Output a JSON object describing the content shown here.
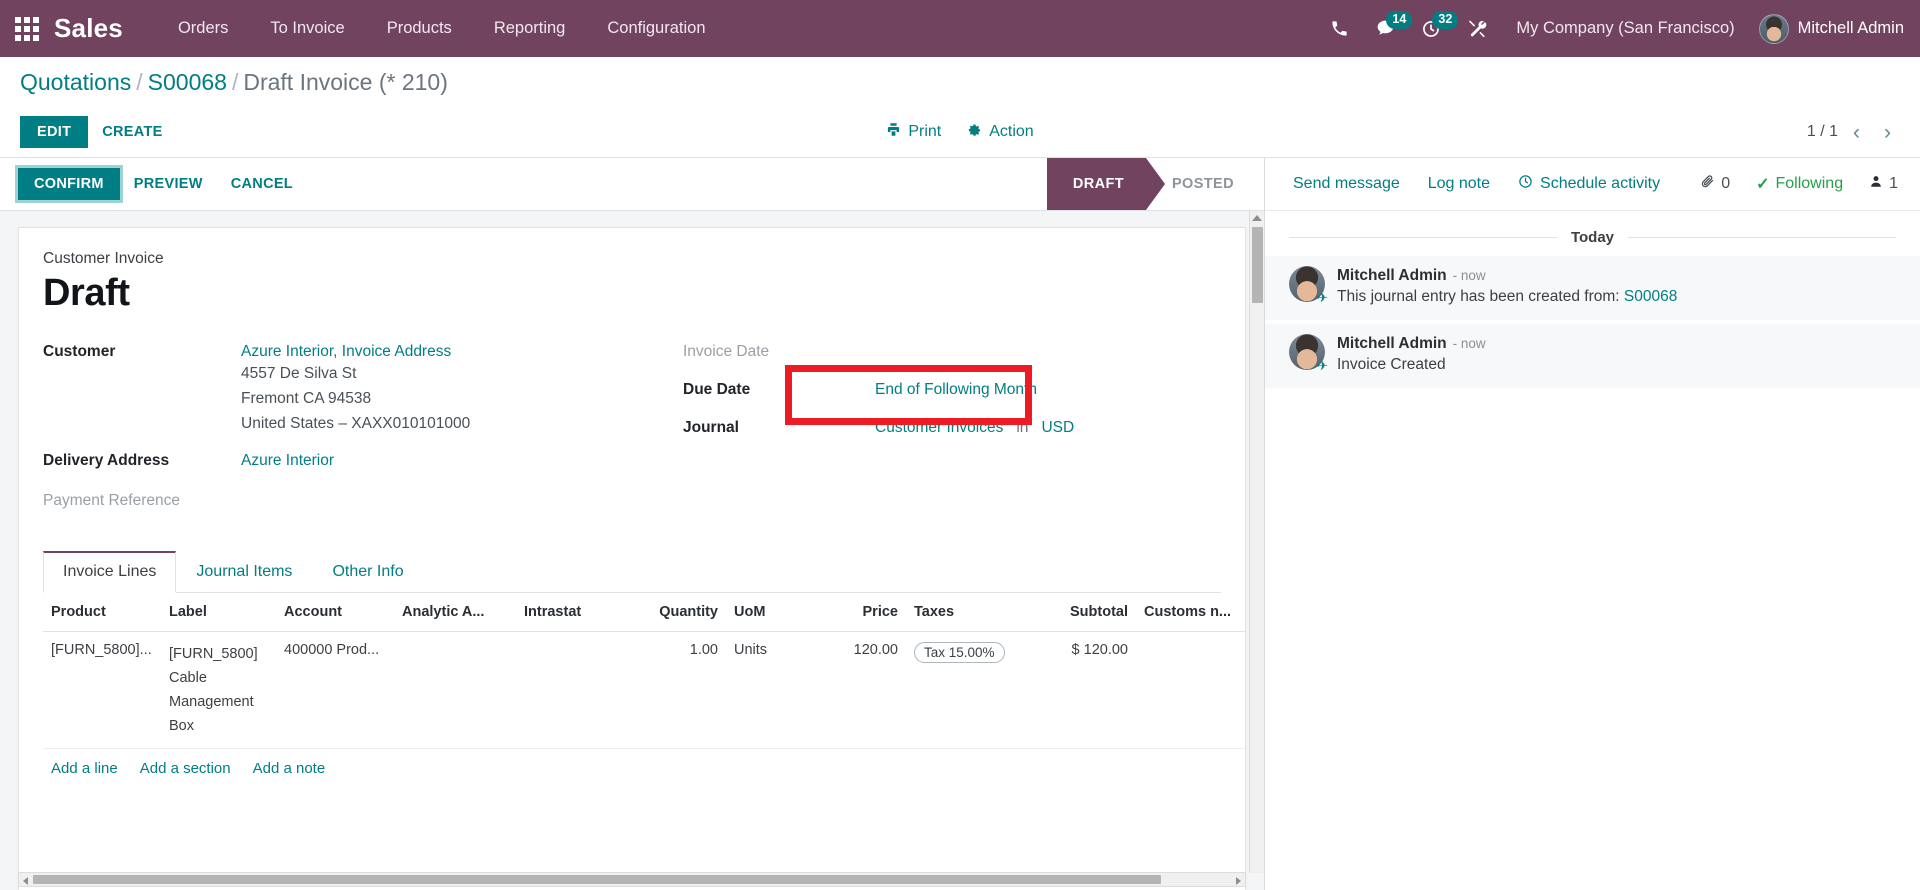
{
  "navbar": {
    "apps_icon": "apps-grid-icon",
    "brand": "Sales",
    "menus": [
      "Orders",
      "To Invoice",
      "Products",
      "Reporting",
      "Configuration"
    ],
    "icons": {
      "phone": "phone-icon",
      "messages": "chat-icon",
      "messages_count": "14",
      "activities": "clock-icon",
      "activities_count": "32",
      "tools": "wrench-screwdriver-icon"
    },
    "company": "My Company (San Francisco)",
    "user": "Mitchell Admin",
    "bg_color": "#71435f",
    "badge_color": "#017e84"
  },
  "control_panel": {
    "breadcrumb": {
      "root": "Quotations",
      "parent": "S00068",
      "current": "Draft Invoice (* 210)",
      "separator": "/"
    },
    "edit_label": "EDIT",
    "create_label": "CREATE",
    "print_label": "Print",
    "print_icon": "printer-icon",
    "action_label": "Action",
    "action_icon": "gear-icon",
    "pager": {
      "text": "1 / 1",
      "prev": "‹",
      "next": "›"
    }
  },
  "statusbar": {
    "buttons": [
      "CONFIRM",
      "PREVIEW",
      "CANCEL"
    ],
    "stages": [
      {
        "label": "DRAFT",
        "active": true
      },
      {
        "label": "POSTED",
        "active": false
      }
    ]
  },
  "form": {
    "type_label": "Customer Invoice",
    "state_title": "Draft",
    "customer": {
      "label": "Customer",
      "name": "Azure Interior, Invoice Address",
      "street": "4557 De Silva St",
      "city": "Fremont CA 94538",
      "country": "United States – XAXX010101000"
    },
    "delivery": {
      "label": "Delivery Address",
      "value": "Azure Interior"
    },
    "payment_reference": {
      "label": "Payment Reference",
      "value": ""
    },
    "invoice_date": {
      "label": "Invoice Date",
      "value": ""
    },
    "due_date": {
      "label": "Due Date",
      "value": "End of Following Month"
    },
    "journal": {
      "label": "Journal",
      "value": "Customer Invoices",
      "in": "in",
      "currency": "USD"
    },
    "highlight_color": "#ed1c24"
  },
  "notebook": {
    "tabs": [
      {
        "label": "Invoice Lines",
        "active": true
      },
      {
        "label": "Journal Items",
        "active": false
      },
      {
        "label": "Other Info",
        "active": false
      }
    ]
  },
  "lines_table": {
    "columns": [
      "Product",
      "Label",
      "Account",
      "Analytic A...",
      "Intrastat",
      "Quantity",
      "UoM",
      "Price",
      "Taxes",
      "Subtotal",
      "Customs n..."
    ],
    "rows": [
      {
        "product": "[FURN_5800]...",
        "label": "[FURN_5800] Cable Management Box",
        "account": "400000 Prod...",
        "analytic": "",
        "intrastat": "",
        "quantity": "1.00",
        "uom": "Units",
        "price": "120.00",
        "taxes": "Tax 15.00%",
        "subtotal": "$ 120.00",
        "customs": ""
      }
    ],
    "add_line": "Add a line",
    "add_section": "Add a section",
    "add_note": "Add a note"
  },
  "chatter": {
    "send_message": "Send message",
    "log_note": "Log note",
    "schedule_activity": "Schedule activity",
    "schedule_icon": "clock-icon",
    "attachment_icon": "paperclip-icon",
    "attachment_count": "0",
    "following_icon": "check-icon",
    "following_label": "Following",
    "followers_icon": "person-icon",
    "followers_count": "1",
    "day_separator": "Today",
    "messages": [
      {
        "author": "Mitchell Admin",
        "time": "- now",
        "text": "This journal entry has been created from: ",
        "link": "S00068"
      },
      {
        "author": "Mitchell Admin",
        "time": "- now",
        "text": "Invoice Created",
        "link": ""
      }
    ]
  }
}
